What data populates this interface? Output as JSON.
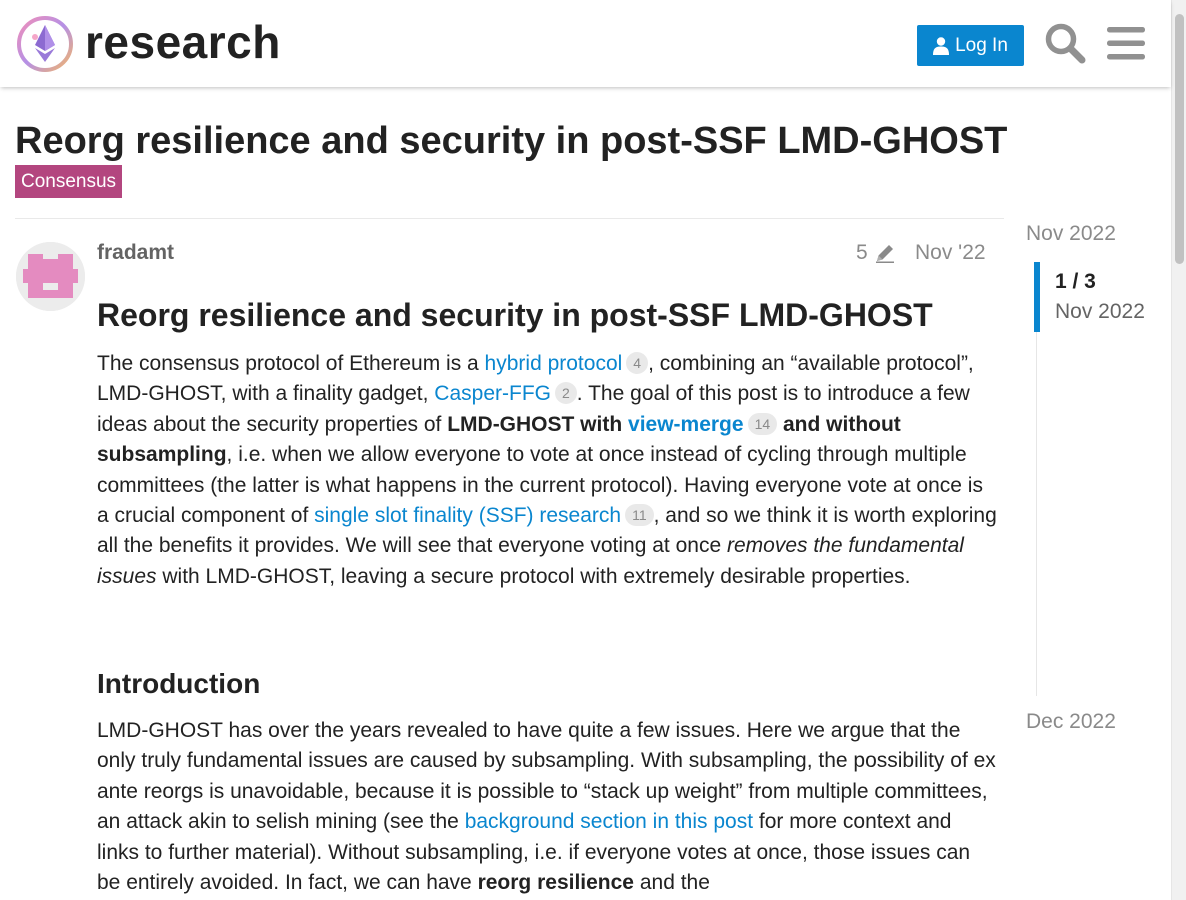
{
  "header": {
    "site_name": "research",
    "login_label": "Log In"
  },
  "topic": {
    "title": "Reorg resilience and security in post-SSF LMD-GHOST",
    "category": "Consensus",
    "category_color": "#b3467f"
  },
  "post": {
    "username": "fradamt",
    "edit_count": "5",
    "date": "Nov '22",
    "heading": "Reorg resilience and security in post-SSF LMD-GHOST",
    "p1": {
      "t1": "The consensus protocol of Ethereum is a ",
      "link1": "hybrid protocol",
      "link1_count": "4",
      "t2": ", combining an “available protocol”, LMD-GHOST, with a finality gadget, ",
      "link2": "Casper-FFG",
      "link2_count": "2",
      "t3": ". The goal of this post is to introduce a few ideas about the security properties of ",
      "b1": "LMD-GHOST with ",
      "link3": "view-merge",
      "link3_count": "14",
      "b2": " and without subsampling",
      "t4": ", i.e. when we allow everyone to vote at once instead of cycling through multiple committees (the latter is what happens in the current protocol). Having everyone vote at once is a crucial component of ",
      "link4": "single slot finality (SSF) research",
      "link4_count": "11",
      "t5": ", and so we think it is worth exploring all the benefits it provides. We will see that everyone voting at once ",
      "i1": "removes the fundamental issues",
      "t6": " with LMD-GHOST, leaving a secure protocol with extremely desirable properties."
    },
    "section_heading": "Introduction",
    "p2": {
      "t1": "LMD-GHOST has over the years revealed to have quite a few issues. Here we argue that the only truly fundamental issues are caused by subsampling. With subsampling, the possibility of ex ante reorgs is unavoidable, because it is possible to “stack up weight” from multiple committees, an attack akin to selish mining (see the ",
      "link1": "background section in this post",
      "t2": " for more context and links to further material). Without subsampling, i.e. if everyone votes at once, those issues can be entirely avoided. In fact, we can have ",
      "b1": "reorg resilience",
      "t3": " and the"
    }
  },
  "timeline": {
    "start": "Nov 2022",
    "position": "1 / 3",
    "position_date": "Nov 2022",
    "end": "Dec 2022"
  },
  "icons": {
    "user": "user-icon",
    "search": "search-icon",
    "menu": "hamburger-menu-icon",
    "pencil": "pencil-icon"
  },
  "colors": {
    "accent": "#0a86cf",
    "category": "#b3467f",
    "avatar": "#e48bc0"
  }
}
